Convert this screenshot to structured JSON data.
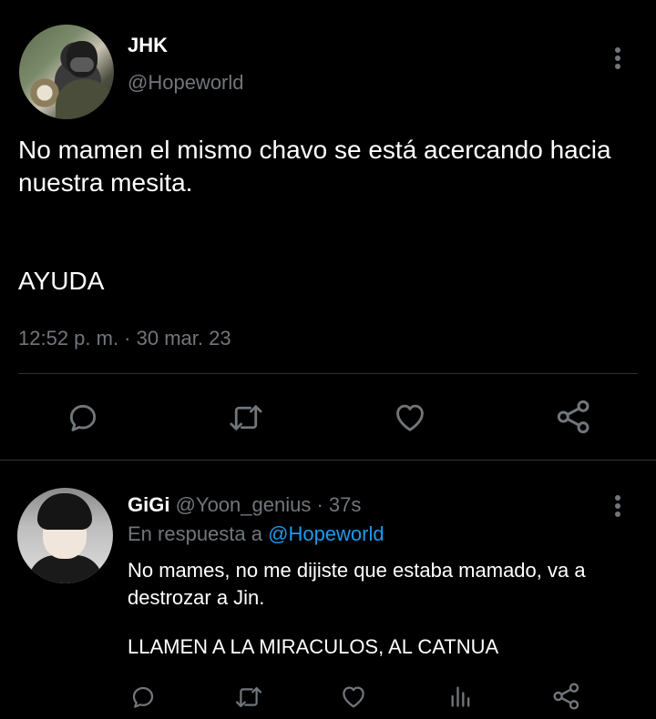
{
  "main_tweet": {
    "name": "JHK",
    "handle": "@Hopeworld",
    "text_1": "No mamen el mismo chavo se está acercando hacia nuestra mesita.",
    "text_2": "AYUDA",
    "timestamp": "12:52 p. m. · 30 mar. 23",
    "actions": [
      "reply-icon",
      "retweet-icon",
      "like-icon",
      "share-icon"
    ]
  },
  "reply_tweet": {
    "name": "GiGi",
    "handle_time": "@Yoon_genius · 37s",
    "reply_prefix": "En respuesta a",
    "reply_to": "@Hopeworld",
    "text_1": "No mames, no me dijiste que estaba mamado, va a destrozar a Jin.",
    "text_2": "LLAMEN A LA MIRACULOS, AL CATNUA",
    "actions": [
      "reply-icon",
      "retweet-icon",
      "like-icon",
      "stats-icon",
      "share-icon"
    ]
  },
  "colors": {
    "background": "#000000",
    "text": "#ffffff",
    "secondary": "#71767b",
    "link": "#1d9bf0",
    "divider": "#2f3336"
  }
}
